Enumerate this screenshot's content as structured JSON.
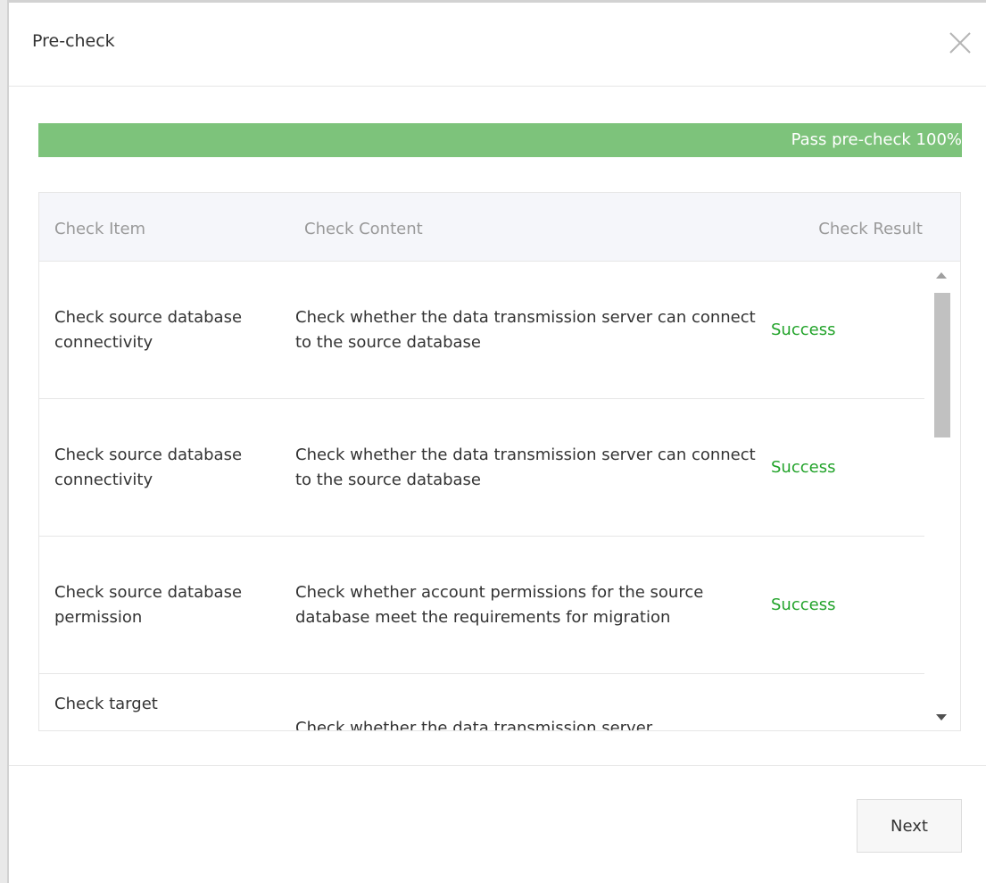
{
  "dialog": {
    "title": "Pre-check",
    "close_icon": "close-icon"
  },
  "progress": {
    "label": "Pass pre-check 100%",
    "percent": 100,
    "color": "#7dc37b"
  },
  "table": {
    "columns": [
      "Check Item",
      "Check Content",
      "Check Result"
    ],
    "rows": [
      {
        "item": "Check source database connectivity",
        "content": "Check whether the data transmission server can connect to the source database",
        "result": "Success"
      },
      {
        "item": "Check source database connectivity",
        "content": "Check whether the data transmission server can connect to the source database",
        "result": "Success"
      },
      {
        "item": "Check source database permission",
        "content": "Check whether account permissions for the source database meet the requirements for migration",
        "result": "Success"
      },
      {
        "item": "Check target",
        "content": "Check whether the data transmission server",
        "result": ""
      }
    ],
    "result_color": "#22a32a"
  },
  "footer": {
    "next_label": "Next"
  }
}
